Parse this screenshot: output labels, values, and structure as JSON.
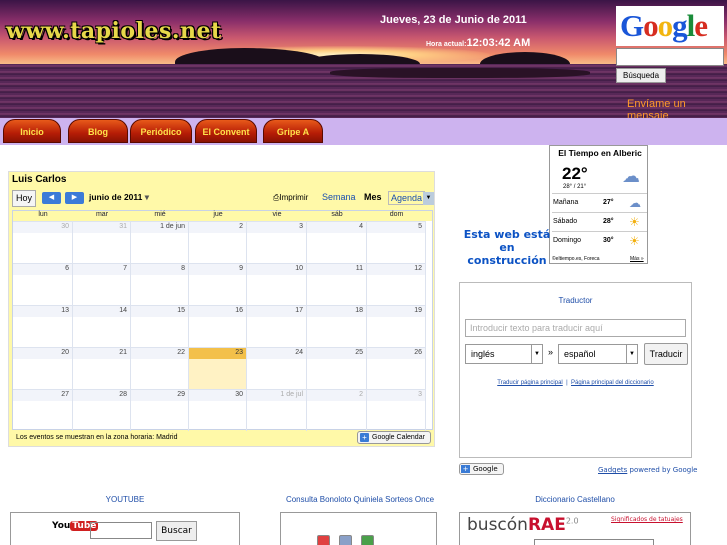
{
  "header": {
    "site_logo": "www.tapioles.net",
    "date": "Jueves, 23 de Junio de 2011",
    "time_label": "Hora actual:",
    "time_value": "12:03:42 AM",
    "google_logo": "Google",
    "google_search_button": "Búsqueda",
    "send_message": "Envíame un mensaje"
  },
  "nav": {
    "items": [
      "Inicio",
      "Blog",
      "Periódico",
      "El Convent",
      "Gripe A"
    ]
  },
  "calendar": {
    "owner": "Luis Carlos",
    "today_button": "Hoy",
    "month_label": "junio de 2011",
    "print_label": "Imprimir",
    "tabs": [
      "Semana",
      "Mes",
      "Agenda"
    ],
    "active_tab": "Mes",
    "day_names": [
      "lun",
      "mar",
      "mié",
      "jue",
      "vie",
      "sáb",
      "dom"
    ],
    "weeks": [
      [
        "30",
        "31",
        "1 de jun",
        "2",
        "3",
        "4",
        "5"
      ],
      [
        "6",
        "7",
        "8",
        "9",
        "10",
        "11",
        "12"
      ],
      [
        "13",
        "14",
        "15",
        "16",
        "17",
        "18",
        "19"
      ],
      [
        "20",
        "21",
        "22",
        "23",
        "24",
        "25",
        "26"
      ],
      [
        "27",
        "28",
        "29",
        "30",
        "1 de jul",
        "2",
        "3"
      ]
    ],
    "today": "23",
    "timezone_note": "Los eventos se muestran en la zona horaria: Madrid",
    "gcal_button": "Google Calendar"
  },
  "weather": {
    "title": "El Tiempo en Alberic",
    "current_temp": "22°",
    "range": "28° / 21°",
    "forecast": [
      {
        "day": "Mañana",
        "temp": "27°",
        "icon": "partly-cloudy-icon"
      },
      {
        "day": "Sábado",
        "temp": "28°",
        "icon": "sun-icon"
      },
      {
        "day": "Domingo",
        "temp": "30°",
        "icon": "sun-icon"
      }
    ],
    "footer": "©eltiempo.es, Foreca",
    "more": "Más »"
  },
  "construction_notice": "Esta web está en construcción",
  "translator": {
    "title": "Traductor",
    "placeholder": "Introducir texto para traducir aquí",
    "source_lang": "inglés",
    "arrow": "»",
    "target_lang": "español",
    "button": "Traducir",
    "link1": "Traducir página principal",
    "link_sep": "|",
    "link2": "Página principal del diccionario",
    "google_button": "Google",
    "gadgets_link": "Gadgets",
    "gadgets_suffix": " powered by Google"
  },
  "bottom": {
    "youtube_title": "YOUTUBE",
    "youtube_logo_1": "You",
    "youtube_logo_2": "Tube",
    "youtube_button": "Buscar",
    "lottery_title": "Consulta Bonoloto Quiniela Sorteos Once",
    "dictionary_title": "Diccionario Castellano",
    "dictionary_logo_1": "buscón",
    "dictionary_logo_2": "RAE",
    "dictionary_logo_3": "2.0",
    "dictionary_link": "Significados de tatuajes"
  },
  "colors": {
    "nav_bg": "#cdb3ef",
    "tab_bg": "#b61d06",
    "tab_text": "#ffe24a",
    "calendar_bg": "#fff9a8",
    "link_blue": "#1f4ea8",
    "send_message": "#ff9a2a"
  }
}
